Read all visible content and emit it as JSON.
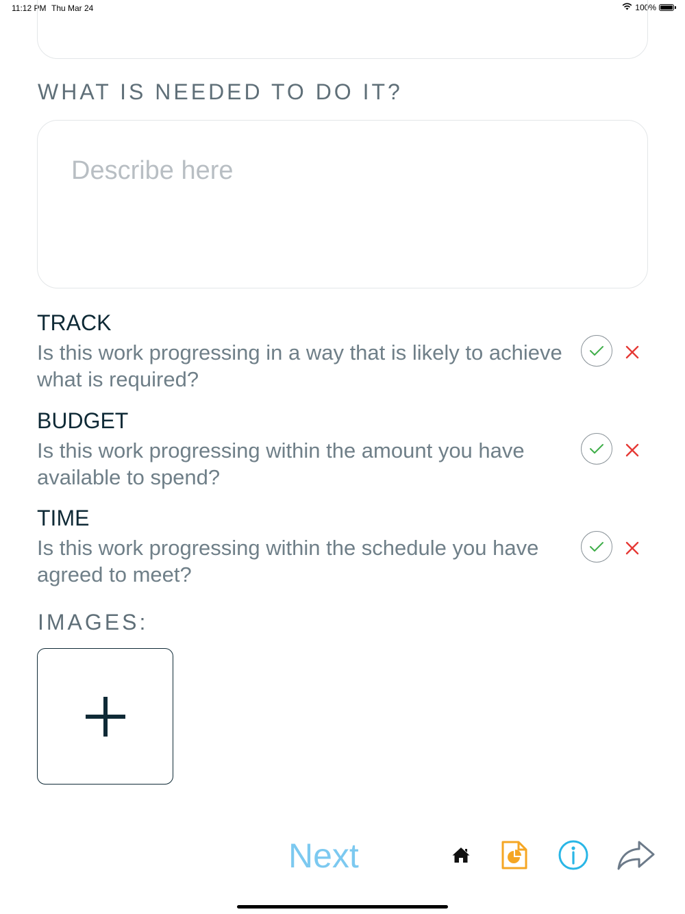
{
  "status_bar": {
    "time": "11:12 PM",
    "date": "Thu Mar 24",
    "battery": "100%"
  },
  "needed": {
    "heading": "WHAT IS NEEDED TO DO IT?",
    "placeholder": "Describe here"
  },
  "checks": [
    {
      "title": "TRACK",
      "description": "Is this work progressing in a way that is likely to achieve what is required?"
    },
    {
      "title": "BUDGET",
      "description": "Is this work progressing within the amount you have available to spend?"
    },
    {
      "title": "TIME",
      "description": "Is this work progressing within the schedule you have agreed to meet?"
    }
  ],
  "images": {
    "heading": "IMAGES:"
  },
  "toolbar": {
    "next_label": "Next",
    "icons": [
      "home-icon",
      "report-icon",
      "info-icon",
      "share-icon"
    ]
  },
  "colors": {
    "accent_blue": "#7cc9f0",
    "check_green": "#3fae49",
    "cross_red": "#e53935",
    "report_orange": "#f5a623",
    "info_cyan": "#29b6e6",
    "share_gray": "#6c7a89",
    "heading_gray": "#5f6f78",
    "dark_text": "#0f2a36"
  }
}
